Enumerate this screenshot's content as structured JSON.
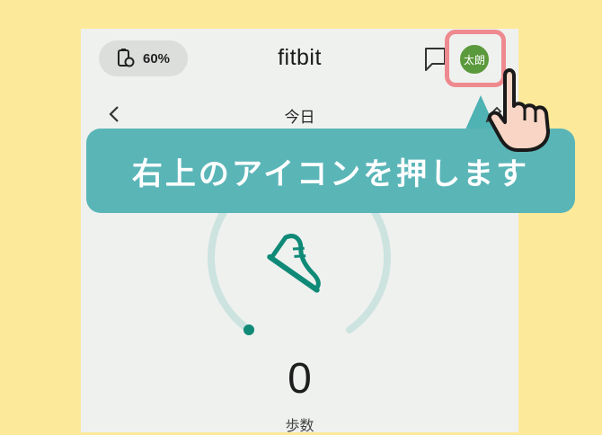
{
  "header": {
    "battery_label": "60%",
    "app_title": "fitbit",
    "avatar_label": "太朗"
  },
  "date_nav": {
    "day_label": "今日"
  },
  "instruction_banner": {
    "text": "右上のアイコンを押します"
  },
  "steps": {
    "value": "0",
    "label": "歩数",
    "progress": 0
  },
  "colors": {
    "background": "#FDE99A",
    "screen": "#EFF1EF",
    "banner": "#5AB5B7",
    "highlight_ring": "#EE8A8F",
    "avatar": "#5B9A3C",
    "accent": "#0F8A77",
    "ring_track": "#CCE3DF"
  },
  "icons": {
    "battery": "watch-battery-icon",
    "message": "message-icon",
    "back": "chevron-left-icon",
    "edit": "pencil-icon",
    "steps": "shoe-icon",
    "pointer": "pointing-hand-icon"
  }
}
